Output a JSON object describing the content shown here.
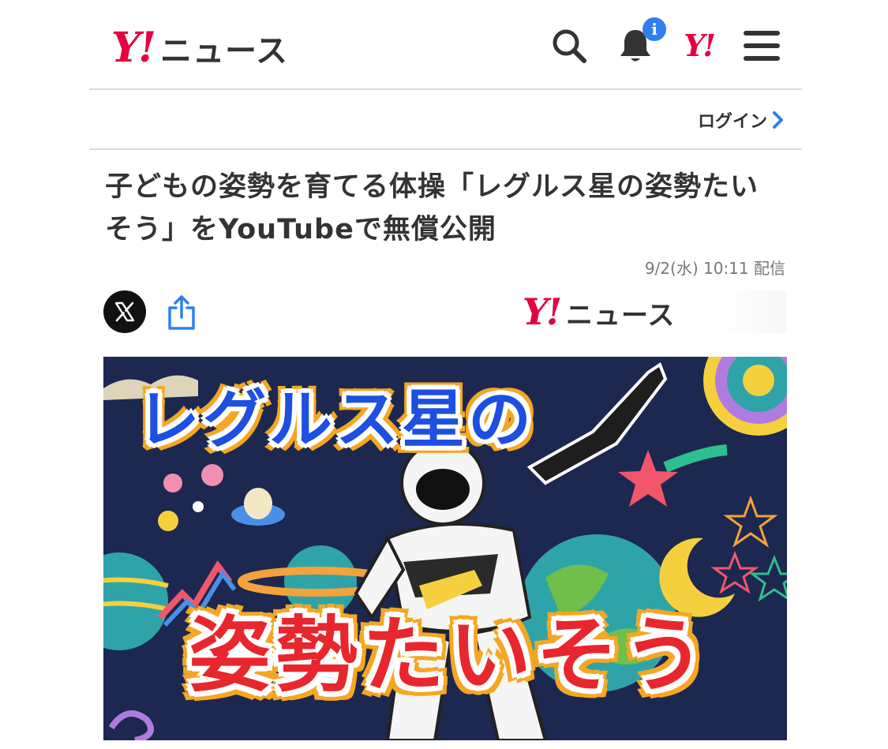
{
  "header": {
    "logo_mark": "Y!",
    "logo_text": "ニュース",
    "notification_badge": "i",
    "yahoo_mark": "Y!"
  },
  "login": {
    "label": "ログイン"
  },
  "article": {
    "title": "子どもの姿勢を育てる体操「レグルス星の姿勢たいそう」をYouTubeで無償公開",
    "date": "9/2(水) 10:11 配信"
  },
  "source": {
    "logo_mark": "Y!",
    "logo_text": "ニュース"
  },
  "hero": {
    "headline_top": "レグルス星の",
    "headline_bottom": "姿勢たいそう"
  },
  "colors": {
    "brand_red": "#e6003f",
    "badge_blue": "#2f80ed",
    "share_blue": "#2f80ed",
    "hero_bg": "#1c2850"
  },
  "icons": [
    "search-icon",
    "bell-icon",
    "menu-icon",
    "chevron-right-icon",
    "x-logo-icon",
    "share-icon"
  ]
}
